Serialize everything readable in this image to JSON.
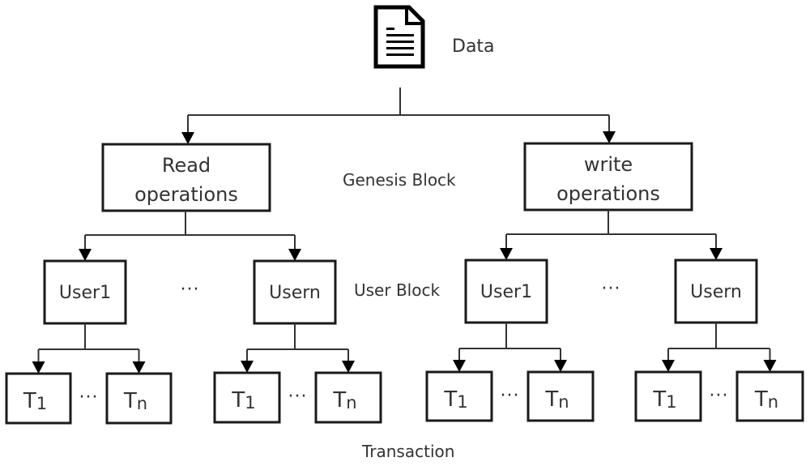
{
  "data_node": {
    "icon": "document-icon",
    "label": "Data"
  },
  "level_labels": {
    "genesis": "Genesis Block",
    "user": "User Block",
    "transaction": "Transaction"
  },
  "ellipsis": "···",
  "branches": [
    {
      "operation": [
        "Read",
        "operations"
      ],
      "users": [
        {
          "label": "User1",
          "transactions": [
            {
              "base": "T",
              "sub": "1"
            },
            {
              "base": "T",
              "sub": "n"
            }
          ]
        },
        {
          "label": "Usern",
          "transactions": [
            {
              "base": "T",
              "sub": "1"
            },
            {
              "base": "T",
              "sub": "n"
            }
          ]
        }
      ]
    },
    {
      "operation": [
        "write",
        "operations"
      ],
      "users": [
        {
          "label": "User1",
          "transactions": [
            {
              "base": "T",
              "sub": "1"
            },
            {
              "base": "T",
              "sub": "n"
            }
          ]
        },
        {
          "label": "Usern",
          "transactions": [
            {
              "base": "T",
              "sub": "1"
            },
            {
              "base": "T",
              "sub": "n"
            }
          ]
        }
      ]
    }
  ]
}
